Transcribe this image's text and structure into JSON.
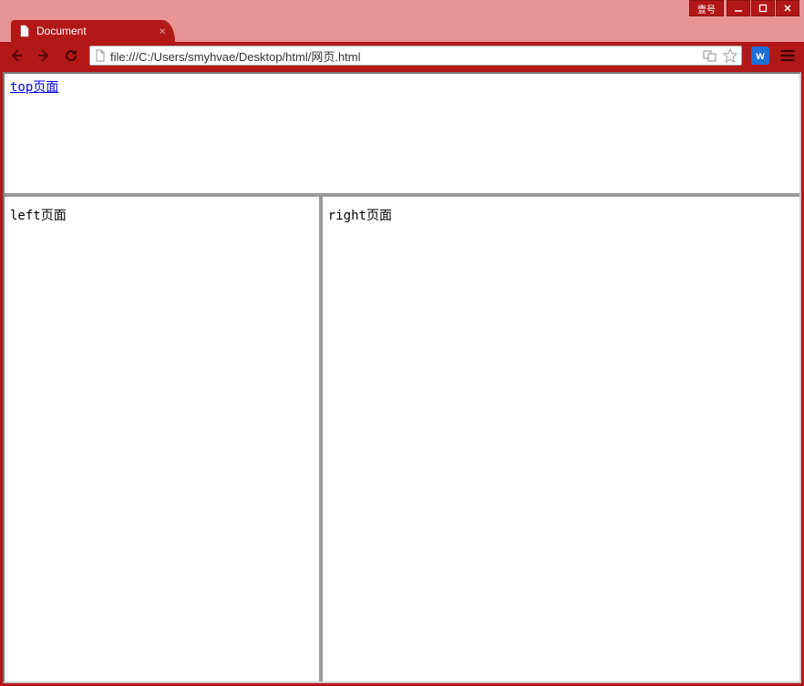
{
  "window": {
    "badge": "壹号"
  },
  "tab": {
    "title": "Document"
  },
  "address": "file:///C:/Users/smyhvae/Desktop/html/网页.html",
  "extension": {
    "letter": "w"
  },
  "frames": {
    "top_link": "top页面",
    "left": "left页面",
    "right": "right页面"
  }
}
